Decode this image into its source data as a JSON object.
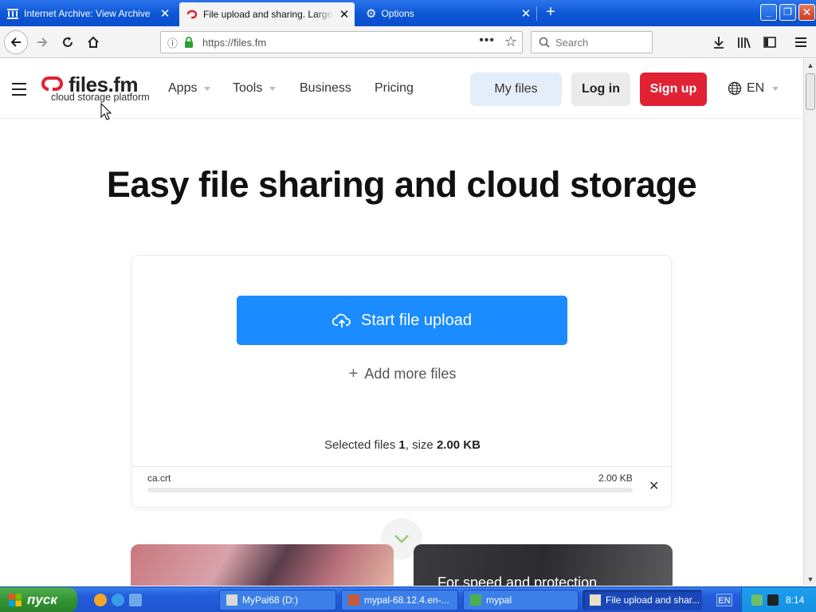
{
  "browser": {
    "tabs": [
      {
        "title": "Internet Archive: View Archive",
        "active": false
      },
      {
        "title": "File upload and sharing. Large file",
        "active": true
      },
      {
        "title": "Options",
        "active": false
      }
    ],
    "url": "https://files.fm",
    "search_placeholder": "Search"
  },
  "site": {
    "logo_name": "files.fm",
    "logo_tagline": "cloud storage platform",
    "nav": {
      "apps": "Apps",
      "tools": "Tools",
      "business": "Business",
      "pricing": "Pricing"
    },
    "my_files": "My files",
    "login": "Log in",
    "signup": "Sign up",
    "language": "EN"
  },
  "hero": {
    "title": "Easy file sharing and cloud storage"
  },
  "upload": {
    "start_label": "Start file upload",
    "add_more_label": "Add more files",
    "selected_prefix": "Selected files ",
    "selected_count": "1",
    "selected_mid": ", size ",
    "selected_size": "2.00 KB",
    "file": {
      "name": "ca.crt",
      "size": "2.00 KB",
      "progress": 0
    }
  },
  "cards": {
    "right_caption": "For speed and protection"
  },
  "taskbar": {
    "start_label": "пуск",
    "tasks": [
      {
        "label": "MyPal68 (D:)"
      },
      {
        "label": "mypal-68.12.4.en-..."
      },
      {
        "label": "mypal"
      },
      {
        "label": "File upload and shar..."
      }
    ],
    "lang": "EN",
    "clock": "8:14"
  },
  "colors": {
    "accent": "#1a8cff",
    "signup": "#e02234",
    "myfiles_bg": "#e4eefb"
  }
}
